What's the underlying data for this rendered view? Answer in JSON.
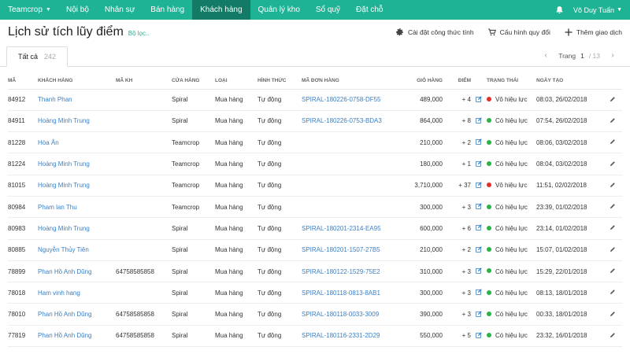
{
  "nav": {
    "brand": "Teamcrop",
    "items": [
      {
        "label": "Nội bộ",
        "active": false
      },
      {
        "label": "Nhân sự",
        "active": false
      },
      {
        "label": "Bán hàng",
        "active": false
      },
      {
        "label": "Khách hàng",
        "active": true
      },
      {
        "label": "Quản lý kho",
        "active": false
      },
      {
        "label": "Sổ quỹ",
        "active": false
      },
      {
        "label": "Đặt chỗ",
        "active": false
      }
    ],
    "user": "Võ Duy Tuấn"
  },
  "header": {
    "title": "Lịch sử tích lũy điểm",
    "filter_link": "Bộ lọc..",
    "actions": {
      "formula": "Cài đặt công thức tính",
      "exchange": "Cấu hình quy đổi",
      "add": "Thêm giao dịch"
    }
  },
  "tabs": [
    {
      "label": "Tất cả",
      "count": "242"
    }
  ],
  "pager": {
    "label": "Trang",
    "current": "1",
    "total": "/ 13"
  },
  "columns": [
    "MÃ",
    "KHÁCH HÀNG",
    "MÃ KH",
    "CỬA HÀNG",
    "LOẠI",
    "HÌNH THỨC",
    "MÃ ĐƠN HÀNG",
    "GIỎ HÀNG",
    "ĐIỂM",
    "",
    "TRẠNG THÁI",
    "NGÀY TẠO",
    ""
  ],
  "colors": {
    "accent": "#1fb395",
    "active_nav": "#127a65",
    "link": "#3a7fc4",
    "valid": "#2bb34a",
    "invalid": "#e0302a"
  },
  "rows": [
    {
      "id": "84912",
      "customer": "Thanh Phan",
      "code": "",
      "store": "Spiral",
      "type": "Mua hàng",
      "mode": "Tự động",
      "order": "SPIRAL-180226-0758-DF55",
      "cart": "489,000",
      "points": "+ 4",
      "status": "Vô hiệu lực",
      "valid": false,
      "date": "08:03, 26/02/2018"
    },
    {
      "id": "84911",
      "customer": "Hoàng Minh Trung",
      "code": "",
      "store": "Spiral",
      "type": "Mua hàng",
      "mode": "Tự động",
      "order": "SPIRAL-180226-0753-BDA3",
      "cart": "864,000",
      "points": "+ 8",
      "status": "Có hiệu lực",
      "valid": true,
      "date": "07:54, 26/02/2018"
    },
    {
      "id": "81228",
      "customer": "Hòa Ân",
      "code": "",
      "store": "Teamcrop",
      "type": "Mua hàng",
      "mode": "Tự động",
      "order": "",
      "cart": "210,000",
      "points": "+ 2",
      "status": "Có hiệu lực",
      "valid": true,
      "date": "08:06, 03/02/2018"
    },
    {
      "id": "81224",
      "customer": "Hoàng Minh Trung",
      "code": "",
      "store": "Teamcrop",
      "type": "Mua hàng",
      "mode": "Tự động",
      "order": "",
      "cart": "180,000",
      "points": "+ 1",
      "status": "Có hiệu lực",
      "valid": true,
      "date": "08:04, 03/02/2018"
    },
    {
      "id": "81015",
      "customer": "Hoàng Minh Trung",
      "code": "",
      "store": "Teamcrop",
      "type": "Mua hàng",
      "mode": "Tự động",
      "order": "",
      "cart": "3,710,000",
      "points": "+ 37",
      "status": "Vô hiệu lực",
      "valid": false,
      "date": "11:51, 02/02/2018"
    },
    {
      "id": "80984",
      "customer": "Pham lan Thu",
      "code": "",
      "store": "Teamcrop",
      "type": "Mua hàng",
      "mode": "Tự động",
      "order": "",
      "cart": "300,000",
      "points": "+ 3",
      "status": "Có hiệu lực",
      "valid": true,
      "date": "23:39, 01/02/2018"
    },
    {
      "id": "80983",
      "customer": "Hoàng Minh Trung",
      "code": "",
      "store": "Spiral",
      "type": "Mua hàng",
      "mode": "Tự động",
      "order": "SPIRAL-180201-2314-EA95",
      "cart": "600,000",
      "points": "+ 6",
      "status": "Có hiệu lực",
      "valid": true,
      "date": "23:14, 01/02/2018"
    },
    {
      "id": "80885",
      "customer": "Nguyễn Thủy Tiên",
      "code": "",
      "store": "Spiral",
      "type": "Mua hàng",
      "mode": "Tự động",
      "order": "SPIRAL-180201-1507-27B5",
      "cart": "210,000",
      "points": "+ 2",
      "status": "Có hiệu lực",
      "valid": true,
      "date": "15:07, 01/02/2018"
    },
    {
      "id": "78899",
      "customer": "Phan Hồ Anh Dũng",
      "code": "64758585858",
      "store": "Spiral",
      "type": "Mua hàng",
      "mode": "Tự động",
      "order": "SPIRAL-180122-1529-75E2",
      "cart": "310,000",
      "points": "+ 3",
      "status": "Có hiệu lực",
      "valid": true,
      "date": "15:29, 22/01/2018"
    },
    {
      "id": "78018",
      "customer": "Ham vinh hang",
      "code": "",
      "store": "Spiral",
      "type": "Mua hàng",
      "mode": "Tự động",
      "order": "SPIRAL-180118-0813-8AB1",
      "cart": "300,000",
      "points": "+ 3",
      "status": "Có hiệu lực",
      "valid": true,
      "date": "08:13, 18/01/2018"
    },
    {
      "id": "78010",
      "customer": "Phan Hồ Anh Dũng",
      "code": "64758585858",
      "store": "Spiral",
      "type": "Mua hàng",
      "mode": "Tự động",
      "order": "SPIRAL-180118-0033-3009",
      "cart": "390,000",
      "points": "+ 3",
      "status": "Có hiệu lực",
      "valid": true,
      "date": "00:33, 18/01/2018"
    },
    {
      "id": "77819",
      "customer": "Phan Hồ Anh Dũng",
      "code": "64758585858",
      "store": "Spiral",
      "type": "Mua hàng",
      "mode": "Tự động",
      "order": "SPIRAL-180116-2331-2D29",
      "cart": "550,000",
      "points": "+ 5",
      "status": "Có hiệu lực",
      "valid": true,
      "date": "23:32, 16/01/2018"
    }
  ]
}
